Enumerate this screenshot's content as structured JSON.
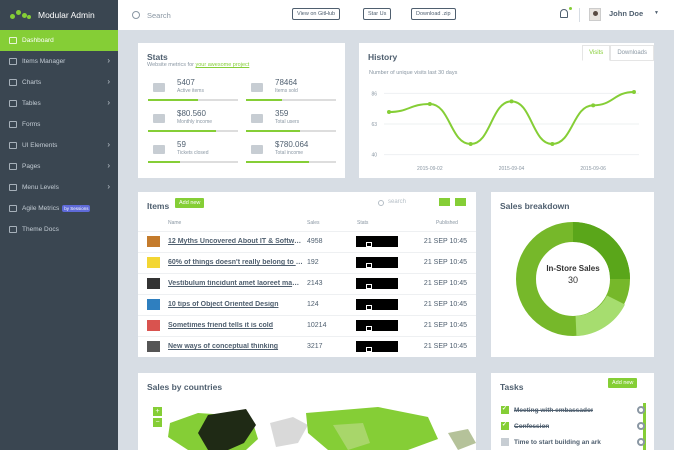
{
  "brand": {
    "name": "Modular Admin"
  },
  "sidebar": {
    "items": [
      {
        "label": "Dashboard",
        "active": true,
        "arrow": false
      },
      {
        "label": "Items Manager",
        "arrow": true
      },
      {
        "label": "Charts",
        "arrow": true
      },
      {
        "label": "Tables",
        "arrow": true
      },
      {
        "label": "Forms",
        "arrow": false
      },
      {
        "label": "UI Elements",
        "arrow": true
      },
      {
        "label": "Pages",
        "arrow": true
      },
      {
        "label": "Menu Levels",
        "arrow": true
      },
      {
        "label": "Agile Metrics",
        "badge": "by Sessions",
        "arrow": false
      },
      {
        "label": "Theme Docs",
        "arrow": false
      }
    ]
  },
  "header": {
    "search_placeholder": "Search",
    "btn_github": "View on GitHub",
    "btn_star": "Star Us",
    "btn_download": "Download .zip",
    "user_name": "John Doe",
    "notif_count": "9"
  },
  "stats": {
    "title": "Stats",
    "subtitle_prefix": "Website metrics for ",
    "subtitle_link": "your awesome project",
    "items": [
      {
        "value": "5407",
        "label": "Active items",
        "icon": "rocket-icon",
        "progress": 0.55
      },
      {
        "value": "78464",
        "label": "Items sold",
        "icon": "cart-icon",
        "progress": 0.4
      },
      {
        "value": "$80.560",
        "label": "Monthly income",
        "icon": "line-chart-icon",
        "progress": 0.75
      },
      {
        "value": "359",
        "label": "Total users",
        "icon": "users-icon",
        "progress": 0.6
      },
      {
        "value": "59",
        "label": "Tickets closed",
        "icon": "list-icon",
        "progress": 0.35
      },
      {
        "value": "$780.064",
        "label": "Total income",
        "icon": "dollar-icon",
        "progress": 0.7
      }
    ]
  },
  "history": {
    "title": "History",
    "tabs": [
      "Visits",
      "Downloads"
    ],
    "active_tab": "Visits",
    "subtitle": "Number of unique visits last 30 days"
  },
  "chart_data": {
    "type": "line",
    "x": [
      "2015-09-01",
      "2015-09-02",
      "2015-09-03",
      "2015-09-04",
      "2015-09-05",
      "2015-09-06",
      "2015-09-07"
    ],
    "x_tick_labels": [
      "2015-09-02",
      "2015-09-04",
      "2015-09-06"
    ],
    "y_ticks": [
      40,
      63,
      86
    ],
    "ylim": [
      36,
      90
    ],
    "series": [
      {
        "values": [
          72,
          78,
          48,
          80,
          48,
          77,
          87
        ]
      }
    ],
    "color": "#85ce36",
    "grid": true
  },
  "items": {
    "title": "Items",
    "add_label": "Add new",
    "search_placeholder": "search",
    "columns": [
      "Name",
      "Sales",
      "Stats",
      "Published"
    ],
    "rows": [
      {
        "name": "12 Myths Uncovered About IT & Software",
        "sales": "4958",
        "published": "21 SEP 10:45",
        "thumb": "#c47b2c"
      },
      {
        "name": "60% of things doesn't really belong to you",
        "sales": "192",
        "published": "21 SEP 10:45",
        "thumb": "#f3d633"
      },
      {
        "name": "Vestibulum tincidunt amet laoreet mauris",
        "sales": "2143",
        "published": "21 SEP 10:45",
        "thumb": "#333333"
      },
      {
        "name": "10 tips of Object Oriented Design",
        "sales": "124",
        "published": "21 SEP 10:45",
        "thumb": "#2f7fbf"
      },
      {
        "name": "Sometimes friend tells it is cold",
        "sales": "10214",
        "published": "21 SEP 10:45",
        "thumb": "#d9534f"
      },
      {
        "name": "New ways of conceptual thinking",
        "sales": "3217",
        "published": "21 SEP 10:45",
        "thumb": "#555555"
      }
    ]
  },
  "breakdown": {
    "title": "Sales breakdown",
    "center_label": "In-Store Sales",
    "center_value": "30"
  },
  "countries": {
    "title": "Sales by countries"
  },
  "tasks": {
    "title": "Tasks",
    "add_label": "Add new",
    "items": [
      {
        "label": "Meeting with embassador",
        "done": true
      },
      {
        "label": "Confession",
        "done": true
      },
      {
        "label": "Time to start building an ark",
        "done": false
      }
    ]
  },
  "colors": {
    "accent": "#85ce36",
    "sidebar": "#3a4651"
  }
}
